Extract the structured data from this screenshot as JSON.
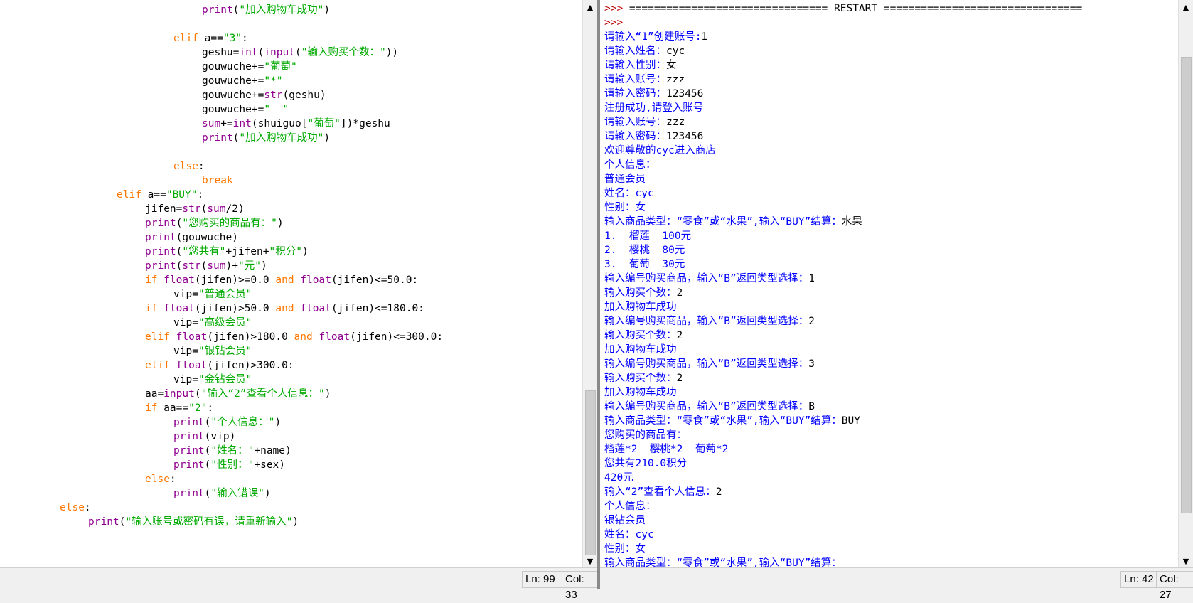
{
  "editor": {
    "lines": [
      {
        "indent": 7,
        "tokens": [
          {
            "c": "bi",
            "t": "print"
          },
          {
            "c": "nm",
            "t": "("
          },
          {
            "c": "st",
            "t": "\"加入购物车成功\""
          },
          {
            "c": "nm",
            "t": ")"
          }
        ]
      },
      {
        "indent": 0,
        "tokens": []
      },
      {
        "indent": 6,
        "tokens": [
          {
            "c": "kw",
            "t": "elif"
          },
          {
            "c": "nm",
            "t": " a=="
          },
          {
            "c": "st",
            "t": "\"3\""
          },
          {
            "c": "nm",
            "t": ":"
          }
        ]
      },
      {
        "indent": 7,
        "tokens": [
          {
            "c": "nm",
            "t": "geshu="
          },
          {
            "c": "bi",
            "t": "int"
          },
          {
            "c": "nm",
            "t": "("
          },
          {
            "c": "bi",
            "t": "input"
          },
          {
            "c": "nm",
            "t": "("
          },
          {
            "c": "st",
            "t": "\"输入购买个数：\""
          },
          {
            "c": "nm",
            "t": "))"
          }
        ]
      },
      {
        "indent": 7,
        "tokens": [
          {
            "c": "nm",
            "t": "gouwuche+="
          },
          {
            "c": "st",
            "t": "\"葡萄\""
          }
        ]
      },
      {
        "indent": 7,
        "tokens": [
          {
            "c": "nm",
            "t": "gouwuche+="
          },
          {
            "c": "st",
            "t": "\"*\""
          }
        ]
      },
      {
        "indent": 7,
        "tokens": [
          {
            "c": "nm",
            "t": "gouwuche+="
          },
          {
            "c": "bi",
            "t": "str"
          },
          {
            "c": "nm",
            "t": "(geshu)"
          }
        ]
      },
      {
        "indent": 7,
        "tokens": [
          {
            "c": "nm",
            "t": "gouwuche+="
          },
          {
            "c": "st",
            "t": "\"  \""
          }
        ]
      },
      {
        "indent": 7,
        "tokens": [
          {
            "c": "bi",
            "t": "sum"
          },
          {
            "c": "nm",
            "t": "+="
          },
          {
            "c": "bi",
            "t": "int"
          },
          {
            "c": "nm",
            "t": "(shuiguo["
          },
          {
            "c": "st",
            "t": "\"葡萄\""
          },
          {
            "c": "nm",
            "t": "])*geshu"
          }
        ]
      },
      {
        "indent": 7,
        "tokens": [
          {
            "c": "bi",
            "t": "print"
          },
          {
            "c": "nm",
            "t": "("
          },
          {
            "c": "st",
            "t": "\"加入购物车成功\""
          },
          {
            "c": "nm",
            "t": ")"
          }
        ]
      },
      {
        "indent": 0,
        "tokens": []
      },
      {
        "indent": 6,
        "tokens": [
          {
            "c": "kw",
            "t": "else"
          },
          {
            "c": "nm",
            "t": ":"
          }
        ]
      },
      {
        "indent": 7,
        "tokens": [
          {
            "c": "kw",
            "t": "break"
          }
        ]
      },
      {
        "indent": 4,
        "tokens": [
          {
            "c": "kw",
            "t": "elif"
          },
          {
            "c": "nm",
            "t": " a=="
          },
          {
            "c": "st",
            "t": "\"BUY\""
          },
          {
            "c": "nm",
            "t": ":"
          }
        ]
      },
      {
        "indent": 5,
        "tokens": [
          {
            "c": "nm",
            "t": "jifen="
          },
          {
            "c": "bi",
            "t": "str"
          },
          {
            "c": "nm",
            "t": "("
          },
          {
            "c": "bi",
            "t": "sum"
          },
          {
            "c": "nm",
            "t": "/2)"
          }
        ]
      },
      {
        "indent": 5,
        "tokens": [
          {
            "c": "bi",
            "t": "print"
          },
          {
            "c": "nm",
            "t": "("
          },
          {
            "c": "st",
            "t": "\"您购买的商品有：\""
          },
          {
            "c": "nm",
            "t": ")"
          }
        ]
      },
      {
        "indent": 5,
        "tokens": [
          {
            "c": "bi",
            "t": "print"
          },
          {
            "c": "nm",
            "t": "(gouwuche)"
          }
        ]
      },
      {
        "indent": 5,
        "tokens": [
          {
            "c": "bi",
            "t": "print"
          },
          {
            "c": "nm",
            "t": "("
          },
          {
            "c": "st",
            "t": "\"您共有\""
          },
          {
            "c": "nm",
            "t": "+jifen+"
          },
          {
            "c": "st",
            "t": "\"积分\""
          },
          {
            "c": "nm",
            "t": ")"
          }
        ]
      },
      {
        "indent": 5,
        "tokens": [
          {
            "c": "bi",
            "t": "print"
          },
          {
            "c": "nm",
            "t": "("
          },
          {
            "c": "bi",
            "t": "str"
          },
          {
            "c": "nm",
            "t": "("
          },
          {
            "c": "bi",
            "t": "sum"
          },
          {
            "c": "nm",
            "t": ")+"
          },
          {
            "c": "st",
            "t": "\"元\""
          },
          {
            "c": "nm",
            "t": ")"
          }
        ]
      },
      {
        "indent": 5,
        "tokens": [
          {
            "c": "kw",
            "t": "if"
          },
          {
            "c": "nm",
            "t": " "
          },
          {
            "c": "bi",
            "t": "float"
          },
          {
            "c": "nm",
            "t": "(jifen)>=0.0 "
          },
          {
            "c": "kw",
            "t": "and"
          },
          {
            "c": "nm",
            "t": " "
          },
          {
            "c": "bi",
            "t": "float"
          },
          {
            "c": "nm",
            "t": "(jifen)<=50.0:"
          }
        ]
      },
      {
        "indent": 6,
        "tokens": [
          {
            "c": "nm",
            "t": "vip="
          },
          {
            "c": "st",
            "t": "\"普通会员\""
          }
        ]
      },
      {
        "indent": 5,
        "tokens": [
          {
            "c": "kw",
            "t": "if"
          },
          {
            "c": "nm",
            "t": " "
          },
          {
            "c": "bi",
            "t": "float"
          },
          {
            "c": "nm",
            "t": "(jifen)>50.0 "
          },
          {
            "c": "kw",
            "t": "and"
          },
          {
            "c": "nm",
            "t": " "
          },
          {
            "c": "bi",
            "t": "float"
          },
          {
            "c": "nm",
            "t": "(jifen)<=180.0:"
          }
        ]
      },
      {
        "indent": 6,
        "tokens": [
          {
            "c": "nm",
            "t": "vip="
          },
          {
            "c": "st",
            "t": "\"高级会员\""
          }
        ]
      },
      {
        "indent": 5,
        "tokens": [
          {
            "c": "kw",
            "t": "elif"
          },
          {
            "c": "nm",
            "t": " "
          },
          {
            "c": "bi",
            "t": "float"
          },
          {
            "c": "nm",
            "t": "(jifen)>180.0 "
          },
          {
            "c": "kw",
            "t": "and"
          },
          {
            "c": "nm",
            "t": " "
          },
          {
            "c": "bi",
            "t": "float"
          },
          {
            "c": "nm",
            "t": "(jifen)<=300.0:"
          }
        ]
      },
      {
        "indent": 6,
        "tokens": [
          {
            "c": "nm",
            "t": "vip="
          },
          {
            "c": "st",
            "t": "\"银钻会员\""
          }
        ]
      },
      {
        "indent": 5,
        "tokens": [
          {
            "c": "kw",
            "t": "elif"
          },
          {
            "c": "nm",
            "t": " "
          },
          {
            "c": "bi",
            "t": "float"
          },
          {
            "c": "nm",
            "t": "(jifen)>300.0:"
          }
        ]
      },
      {
        "indent": 6,
        "tokens": [
          {
            "c": "nm",
            "t": "vip="
          },
          {
            "c": "st",
            "t": "\"金钻会员\""
          }
        ]
      },
      {
        "indent": 5,
        "tokens": [
          {
            "c": "nm",
            "t": "aa="
          },
          {
            "c": "bi",
            "t": "input"
          },
          {
            "c": "nm",
            "t": "("
          },
          {
            "c": "st",
            "t": "\"输入“2”查看个人信息：\""
          },
          {
            "c": "nm",
            "t": ")"
          }
        ]
      },
      {
        "indent": 5,
        "tokens": [
          {
            "c": "kw",
            "t": "if"
          },
          {
            "c": "nm",
            "t": " aa=="
          },
          {
            "c": "st",
            "t": "\"2\""
          },
          {
            "c": "nm",
            "t": ":"
          }
        ]
      },
      {
        "indent": 6,
        "tokens": [
          {
            "c": "bi",
            "t": "print"
          },
          {
            "c": "nm",
            "t": "("
          },
          {
            "c": "st",
            "t": "\"个人信息：\""
          },
          {
            "c": "nm",
            "t": ")"
          }
        ]
      },
      {
        "indent": 6,
        "tokens": [
          {
            "c": "bi",
            "t": "print"
          },
          {
            "c": "nm",
            "t": "(vip)"
          }
        ]
      },
      {
        "indent": 6,
        "tokens": [
          {
            "c": "bi",
            "t": "print"
          },
          {
            "c": "nm",
            "t": "("
          },
          {
            "c": "st",
            "t": "\"姓名：\""
          },
          {
            "c": "nm",
            "t": "+name)"
          }
        ]
      },
      {
        "indent": 6,
        "tokens": [
          {
            "c": "bi",
            "t": "print"
          },
          {
            "c": "nm",
            "t": "("
          },
          {
            "c": "st",
            "t": "\"性别：\""
          },
          {
            "c": "nm",
            "t": "+sex)"
          }
        ]
      },
      {
        "indent": 5,
        "tokens": [
          {
            "c": "kw",
            "t": "else"
          },
          {
            "c": "nm",
            "t": ":"
          }
        ]
      },
      {
        "indent": 6,
        "tokens": [
          {
            "c": "bi",
            "t": "print"
          },
          {
            "c": "nm",
            "t": "("
          },
          {
            "c": "st",
            "t": "\"输入错误\""
          },
          {
            "c": "nm",
            "t": ")"
          }
        ]
      },
      {
        "indent": 2,
        "tokens": [
          {
            "c": "kw",
            "t": "else"
          },
          {
            "c": "nm",
            "t": ":"
          }
        ]
      },
      {
        "indent": 3,
        "tokens": [
          {
            "c": "bi",
            "t": "print"
          },
          {
            "c": "nm",
            "t": "("
          },
          {
            "c": "st",
            "t": "\"输入账号或密码有误，请重新输入\""
          },
          {
            "c": "nm",
            "t": ")"
          }
        ]
      }
    ],
    "status": {
      "ln": "Ln: 99",
      "col": "Col: 33"
    }
  },
  "shell": {
    "lines": [
      {
        "tokens": [
          {
            "c": "prm",
            "t": ">>> "
          },
          {
            "c": "inp",
            "t": "================================ RESTART ================================"
          }
        ]
      },
      {
        "tokens": [
          {
            "c": "prm",
            "t": ">>> "
          }
        ]
      },
      {
        "tokens": [
          {
            "c": "out",
            "t": "请输入“1”创建账号:"
          },
          {
            "c": "inp",
            "t": "1"
          }
        ]
      },
      {
        "tokens": [
          {
            "c": "out",
            "t": "请输入姓名："
          },
          {
            "c": "inp",
            "t": "cyc"
          }
        ]
      },
      {
        "tokens": [
          {
            "c": "out",
            "t": "请输入性别："
          },
          {
            "c": "inp",
            "t": "女"
          }
        ]
      },
      {
        "tokens": [
          {
            "c": "out",
            "t": "请输入账号："
          },
          {
            "c": "inp",
            "t": "zzz"
          }
        ]
      },
      {
        "tokens": [
          {
            "c": "out",
            "t": "请输入密码："
          },
          {
            "c": "inp",
            "t": "123456"
          }
        ]
      },
      {
        "tokens": [
          {
            "c": "out",
            "t": "注册成功,请登入账号"
          }
        ]
      },
      {
        "tokens": [
          {
            "c": "out",
            "t": "请输入账号："
          },
          {
            "c": "inp",
            "t": "zzz"
          }
        ]
      },
      {
        "tokens": [
          {
            "c": "out",
            "t": "请输入密码："
          },
          {
            "c": "inp",
            "t": "123456"
          }
        ]
      },
      {
        "tokens": [
          {
            "c": "out",
            "t": "欢迎尊敬的cyc进入商店"
          }
        ]
      },
      {
        "tokens": [
          {
            "c": "out",
            "t": "个人信息："
          }
        ]
      },
      {
        "tokens": [
          {
            "c": "out",
            "t": "普通会员"
          }
        ]
      },
      {
        "tokens": [
          {
            "c": "out",
            "t": "姓名：cyc"
          }
        ]
      },
      {
        "tokens": [
          {
            "c": "out",
            "t": "性别：女"
          }
        ]
      },
      {
        "tokens": [
          {
            "c": "out",
            "t": "输入商品类型：“零食”或“水果”,输入“BUY”结算："
          },
          {
            "c": "inp",
            "t": "水果"
          }
        ]
      },
      {
        "tokens": [
          {
            "c": "out",
            "t": "1.  榴莲  100元"
          }
        ]
      },
      {
        "tokens": [
          {
            "c": "out",
            "t": "2.  樱桃  80元"
          }
        ]
      },
      {
        "tokens": [
          {
            "c": "out",
            "t": "3.  葡萄  30元"
          }
        ]
      },
      {
        "tokens": [
          {
            "c": "out",
            "t": "输入编号购买商品，输入“B”返回类型选择："
          },
          {
            "c": "inp",
            "t": "1"
          }
        ]
      },
      {
        "tokens": [
          {
            "c": "out",
            "t": "输入购买个数："
          },
          {
            "c": "inp",
            "t": "2"
          }
        ]
      },
      {
        "tokens": [
          {
            "c": "out",
            "t": "加入购物车成功"
          }
        ]
      },
      {
        "tokens": [
          {
            "c": "out",
            "t": "输入编号购买商品，输入“B”返回类型选择："
          },
          {
            "c": "inp",
            "t": "2"
          }
        ]
      },
      {
        "tokens": [
          {
            "c": "out",
            "t": "输入购买个数："
          },
          {
            "c": "inp",
            "t": "2"
          }
        ]
      },
      {
        "tokens": [
          {
            "c": "out",
            "t": "加入购物车成功"
          }
        ]
      },
      {
        "tokens": [
          {
            "c": "out",
            "t": "输入编号购买商品，输入“B”返回类型选择："
          },
          {
            "c": "inp",
            "t": "3"
          }
        ]
      },
      {
        "tokens": [
          {
            "c": "out",
            "t": "输入购买个数："
          },
          {
            "c": "inp",
            "t": "2"
          }
        ]
      },
      {
        "tokens": [
          {
            "c": "out",
            "t": "加入购物车成功"
          }
        ]
      },
      {
        "tokens": [
          {
            "c": "out",
            "t": "输入编号购买商品，输入“B”返回类型选择："
          },
          {
            "c": "inp",
            "t": "B"
          }
        ]
      },
      {
        "tokens": [
          {
            "c": "out",
            "t": "输入商品类型：“零食”或“水果”,输入“BUY”结算："
          },
          {
            "c": "inp",
            "t": "BUY"
          }
        ]
      },
      {
        "tokens": [
          {
            "c": "out",
            "t": "您购买的商品有："
          }
        ]
      },
      {
        "tokens": [
          {
            "c": "out",
            "t": "榴莲*2  樱桃*2  葡萄*2"
          }
        ]
      },
      {
        "tokens": [
          {
            "c": "out",
            "t": "您共有210.0积分"
          }
        ]
      },
      {
        "tokens": [
          {
            "c": "out",
            "t": "420元"
          }
        ]
      },
      {
        "tokens": [
          {
            "c": "out",
            "t": "输入“2”查看个人信息："
          },
          {
            "c": "inp",
            "t": "2"
          }
        ]
      },
      {
        "tokens": [
          {
            "c": "out",
            "t": "个人信息："
          }
        ]
      },
      {
        "tokens": [
          {
            "c": "out",
            "t": "银钻会员"
          }
        ]
      },
      {
        "tokens": [
          {
            "c": "out",
            "t": "姓名：cyc"
          }
        ]
      },
      {
        "tokens": [
          {
            "c": "out",
            "t": "性别：女"
          }
        ]
      },
      {
        "tokens": [
          {
            "c": "out",
            "t": "输入商品类型：“零食”或“水果”,输入“BUY”结算："
          }
        ]
      }
    ],
    "status": {
      "ln": "Ln: 42",
      "col": "Col: 27"
    }
  },
  "scrollbars": {
    "up_glyph": "▲",
    "down_glyph": "▼",
    "editor_scroll_fraction": 1.0,
    "shell_scroll_fraction": 0.5
  },
  "colors": {
    "keyword": "#ff7700",
    "builtin": "#900090",
    "string": "#00aa00",
    "stdout": "#0000ff",
    "prompt": "#c00000"
  }
}
